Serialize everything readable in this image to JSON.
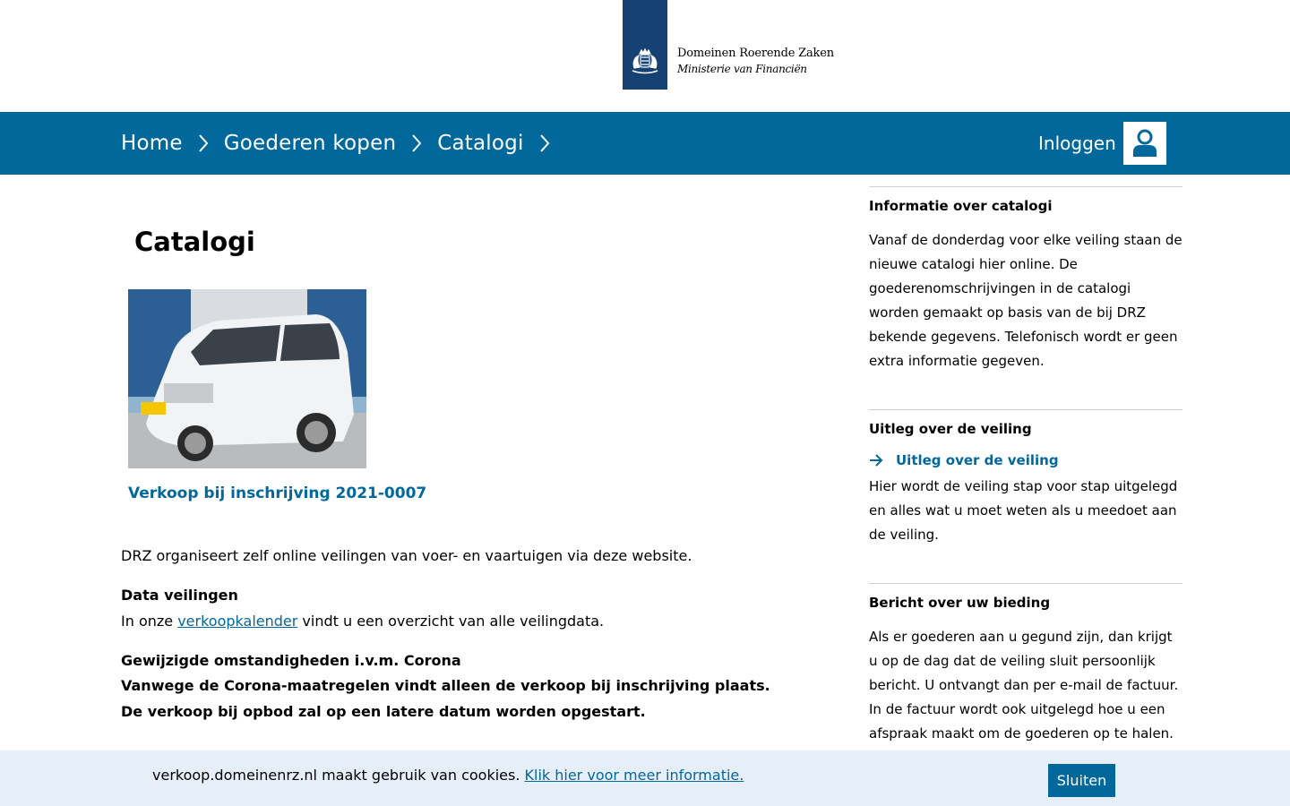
{
  "header": {
    "org_name": "Domeinen Roerende Zaken",
    "ministry": "Ministerie van Financiën",
    "logo_icon": "royal-emblem-icon"
  },
  "nav": {
    "breadcrumbs": [
      {
        "label": "Home"
      },
      {
        "label": "Goederen kopen"
      },
      {
        "label": "Catalogi"
      }
    ],
    "login_label": "Inloggen",
    "user_icon": "user-icon"
  },
  "main": {
    "title": "Catalogi",
    "card": {
      "image": "white-minivan-photo",
      "link_label": "Verkoop bij inschrijving 2021-0007"
    },
    "intro": "DRZ organiseert zelf online veilingen van voer- en vaartuigen via deze website.",
    "data_heading": "Data veilingen",
    "data_prefix": "In onze ",
    "data_link": "verkoopkalender",
    "data_suffix": " vindt u een overzicht van alle veilingdata.",
    "corona_heading": "Gewijzigde omstandigheden i.v.m. Corona",
    "corona_body": "Vanwege de Corona-maatregelen vindt alleen de verkoop bij inschrijving plaats. De verkoop bij opbod zal op een latere datum worden opgestart."
  },
  "sidebar": {
    "sections": [
      {
        "heading": "Informatie over catalogi",
        "text": "Vanaf de donderdag voor elke veiling staan de nieuwe catalogi hier online. De goederenomschrijvingen in de catalogi worden gemaakt op basis van de bij DRZ bekende gegevens. Telefonisch wordt er geen extra informatie gegeven."
      },
      {
        "heading": "Uitleg over de veiling",
        "link_label": "Uitleg over de veiling",
        "text": "Hier wordt de veiling stap voor stap uitgelegd en alles wat u moet weten als u meedoet aan de veiling."
      },
      {
        "heading": "Bericht over uw bieding",
        "text": "Als er goederen aan u gegund zijn, dan krijgt u op de dag dat de veiling sluit persoonlijk bericht. U ontvangt dan per e-mail de factuur. In de factuur wordt ook uitgelegd hoe u een afspraak maakt om de goederen op te halen."
      }
    ]
  },
  "cookie": {
    "text": "verkoop.domeinenrz.nl maakt gebruik van cookies. ",
    "link": "Klik hier voor meer informatie.",
    "close_label": "Sluiten"
  },
  "colors": {
    "brand_blue": "#01689b",
    "logo_blue": "#154273",
    "cookie_bg": "#e6eff8"
  }
}
